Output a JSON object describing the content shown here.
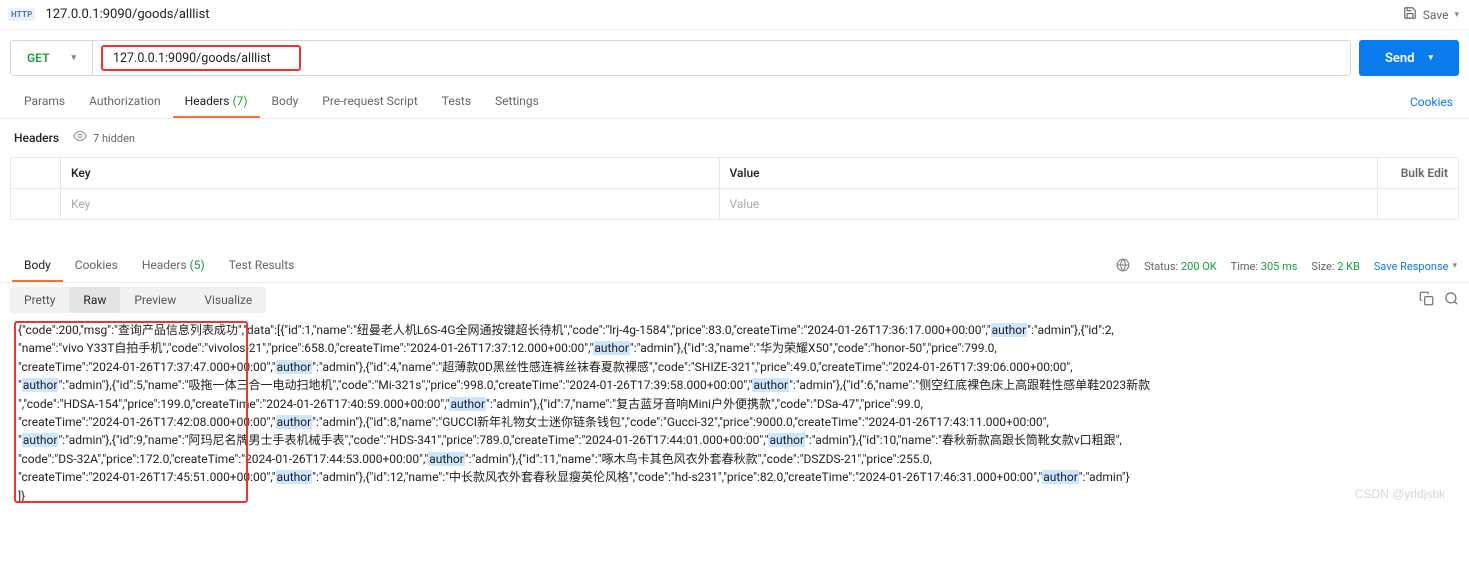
{
  "top": {
    "badge": "HTTP",
    "path": "127.0.0.1:9090/goods/alllist",
    "save": "Save"
  },
  "request": {
    "method": "GET",
    "url": "127.0.0.1:9090/goods/alllist",
    "send": "Send"
  },
  "tabs": {
    "params": "Params",
    "authorization": "Authorization",
    "headers": "Headers",
    "headers_count": "(7)",
    "body": "Body",
    "prerequest": "Pre-request Script",
    "tests": "Tests",
    "settings": "Settings",
    "cookies": "Cookies"
  },
  "headersSub": {
    "title": "Headers",
    "hidden": "7 hidden"
  },
  "kv": {
    "keyH": "Key",
    "valH": "Value",
    "bulk": "Bulk Edit",
    "keyP": "Key",
    "valP": "Value"
  },
  "respTabs": {
    "body": "Body",
    "cookies": "Cookies",
    "headers": "Headers",
    "headers_count": "(5)",
    "testResults": "Test Results"
  },
  "respMeta": {
    "statusL": "Status:",
    "status": "200 OK",
    "timeL": "Time:",
    "time": "305 ms",
    "sizeL": "Size:",
    "size": "2 KB",
    "saveResp": "Save Response"
  },
  "viewTabs": {
    "pretty": "Pretty",
    "raw": "Raw",
    "preview": "Preview",
    "visualize": "Visualize"
  },
  "response_json": {
    "code": 200,
    "msg": "查询产品信息列表成功",
    "data": [
      {
        "id": 1,
        "name": "纽曼老人机L6S-4G全网通按键超长待机",
        "code": "lrj-4g-1584",
        "price": 83.0,
        "createTime": "2024-01-26T17:36:17.000+00:00",
        "author": "admin"
      },
      {
        "id": 2,
        "name": "vivo Y33T自拍手机",
        "code": "vivolos-21",
        "price": 658.0,
        "createTime": "2024-01-26T17:37:12.000+00:00",
        "author": "admin"
      },
      {
        "id": 3,
        "name": "华为荣耀X50",
        "code": "honor-50",
        "price": 799.0,
        "createTime": "2024-01-26T17:37:47.000+00:00",
        "author": "admin"
      },
      {
        "id": 4,
        "name": "超薄款0D黑丝性感连裤丝袜春夏款裸感",
        "code": "SHIZE-321",
        "price": 49.0,
        "createTime": "2024-01-26T17:39:06.000+00:00",
        "author": "admin"
      },
      {
        "id": 5,
        "name": "吸拖一体三合一电动扫地机",
        "code": "Mi-321s",
        "price": 998.0,
        "createTime": "2024-01-26T17:39:58.000+00:00",
        "author": "admin"
      },
      {
        "id": 6,
        "name": "侧空红底裸色床上高跟鞋性感单鞋2023新款",
        "code": "HDSA-154",
        "price": 199.0,
        "createTime": "2024-01-26T17:40:59.000+00:00",
        "author": "admin"
      },
      {
        "id": 7,
        "name": "复古蓝牙音响Mini户外便携款",
        "code": "DSa-47",
        "price": 99.0,
        "createTime": "2024-01-26T17:42:08.000+00:00",
        "author": "admin"
      },
      {
        "id": 8,
        "name": "GUCCI新年礼物女士迷你链条钱包",
        "code": "Gucci-32",
        "price": 9000.0,
        "createTime": "2024-01-26T17:43:11.000+00:00",
        "author": "admin"
      },
      {
        "id": 9,
        "name": "阿玛尼名牌男士手表机械手表",
        "code": "HDS-341",
        "price": 789.0,
        "createTime": "2024-01-26T17:44:01.000+00:00",
        "author": "admin"
      },
      {
        "id": 10,
        "name": "春秋新款高跟长筒靴女款v口粗跟",
        "code": "DS-32A",
        "price": 172.0,
        "createTime": "2024-01-26T17:44:53.000+00:00",
        "author": "admin"
      },
      {
        "id": 11,
        "name": "啄木鸟卡其色风衣外套春秋款",
        "code": "DSZDS-21",
        "price": 255.0,
        "createTime": "2024-01-26T17:45:51.000+00:00",
        "author": "admin"
      },
      {
        "id": 12,
        "name": "中长款风衣外套春秋显瘦英伦风格",
        "code": "hd-s231",
        "price": 82.0,
        "createTime": "2024-01-26T17:46:31.000+00:00",
        "author": "admin"
      }
    ]
  },
  "body_lines": [
    [
      {
        "t": "{\"code\":200,\"msg\":\"查询产品信息列表成功\",\"data\":[{\"id\":1,\"name\":\"纽曼老人机L6S-4G全网通按键超长待机\",\"code\":\"lrj-4g-1584\",\"price\":83.0,\"createTime\":\"2024-01-26T17:36:17.000+00:00\",\""
      },
      {
        "t": "author",
        "hl": 1
      },
      {
        "t": "\":\"admin\"},{\"id\":2,"
      }
    ],
    [
      {
        "t": "\"name\":\"vivo Y33T自拍手机\",\"code\":\"vivolos-21\",\"price\":658.0,\"createTime\":\"2024-01-26T17:37:12.000+00:00\",\""
      },
      {
        "t": "author",
        "hl": 1
      },
      {
        "t": "\":\"admin\"},{\"id\":3,\"name\":\"华为荣耀X50\",\"code\":\"honor-50\",\"price\":799.0,"
      }
    ],
    [
      {
        "t": "\"createTime\":\"2024-01-26T17:37:47.000+00:00\",\""
      },
      {
        "t": "author",
        "hl": 1
      },
      {
        "t": "\":\"admin\"},{\"id\":4,\"name\":\"超薄款0D黑丝性感连裤丝袜春夏款裸感\",\"code\":\"SHIZE-321\",\"price\":49.0,\"createTime\":\"2024-01-26T17:39:06.000+00:00\","
      }
    ],
    [
      {
        "t": "\""
      },
      {
        "t": "author",
        "hl": 1
      },
      {
        "t": "\":\"admin\"},{\"id\":5,\"name\":\"吸拖一体三合一电动扫地机\",\"code\":\"Mi-321s\",\"price\":998.0,\"createTime\":\"2024-01-26T17:39:58.000+00:00\",\""
      },
      {
        "t": "author",
        "hl": 1
      },
      {
        "t": "\":\"admin\"},{\"id\":6,\"name\":\"侧空红底裸色床上高跟鞋性感单鞋2023新款"
      }
    ],
    [
      {
        "t": "\",\"code\":\"HDSA-154\",\"price\":199.0,\"createTime\":\"2024-01-26T17:40:59.000+00:00\",\""
      },
      {
        "t": "author",
        "hl": 1
      },
      {
        "t": "\":\"admin\"},{\"id\":7,\"name\":\"复古蓝牙音响Mini户外便携款\",\"code\":\"DSa-47\",\"price\":99.0,"
      }
    ],
    [
      {
        "t": "\"createTime\":\"2024-01-26T17:42:08.000+00:00\",\""
      },
      {
        "t": "author",
        "hl": 1
      },
      {
        "t": "\":\"admin\"},{\"id\":8,\"name\":\"GUCCI新年礼物女士迷你链条钱包\",\"code\":\"Gucci-32\",\"price\":9000.0,\"createTime\":\"2024-01-26T17:43:11.000+00:00\","
      }
    ],
    [
      {
        "t": "\""
      },
      {
        "t": "author",
        "hl": 1
      },
      {
        "t": "\":\"admin\"},{\"id\":9,\"name\":\"阿玛尼名牌男士手表机械手表\",\"code\":\"HDS-341\",\"price\":789.0,\"createTime\":\"2024-01-26T17:44:01.000+00:00\",\""
      },
      {
        "t": "author",
        "hl": 1
      },
      {
        "t": "\":\"admin\"},{\"id\":10,\"name\":\"春秋新款高跟长筒靴女款v口粗跟\","
      }
    ],
    [
      {
        "t": "\"code\":\"DS-32A\",\"price\":172.0,\"createTime\":\"2024-01-26T17:44:53.000+00:00\",\""
      },
      {
        "t": "author",
        "hl": 1
      },
      {
        "t": "\":\"admin\"},{\"id\":11,\"name\":\"啄木鸟卡其色风衣外套春秋款\",\"code\":\"DSZDS-21\",\"price\":255.0,"
      }
    ],
    [
      {
        "t": "\"createTime\":\"2024-01-26T17:45:51.000+00:00\",\""
      },
      {
        "t": "author",
        "hl": 1
      },
      {
        "t": "\":\"admin\"},{\"id\":12,\"name\":\"中长款风衣外套春秋显瘦英伦风格\",\"code\":\"hd-s231\",\"price\":82.0,\"createTime\":\"2024-01-26T17:46:31.000+00:00\",\""
      },
      {
        "t": "author",
        "hl": 1
      },
      {
        "t": "\":\"admin\"}"
      }
    ],
    [
      {
        "t": "]}"
      }
    ]
  ],
  "watermark": "CSDN @yrldjsbk"
}
